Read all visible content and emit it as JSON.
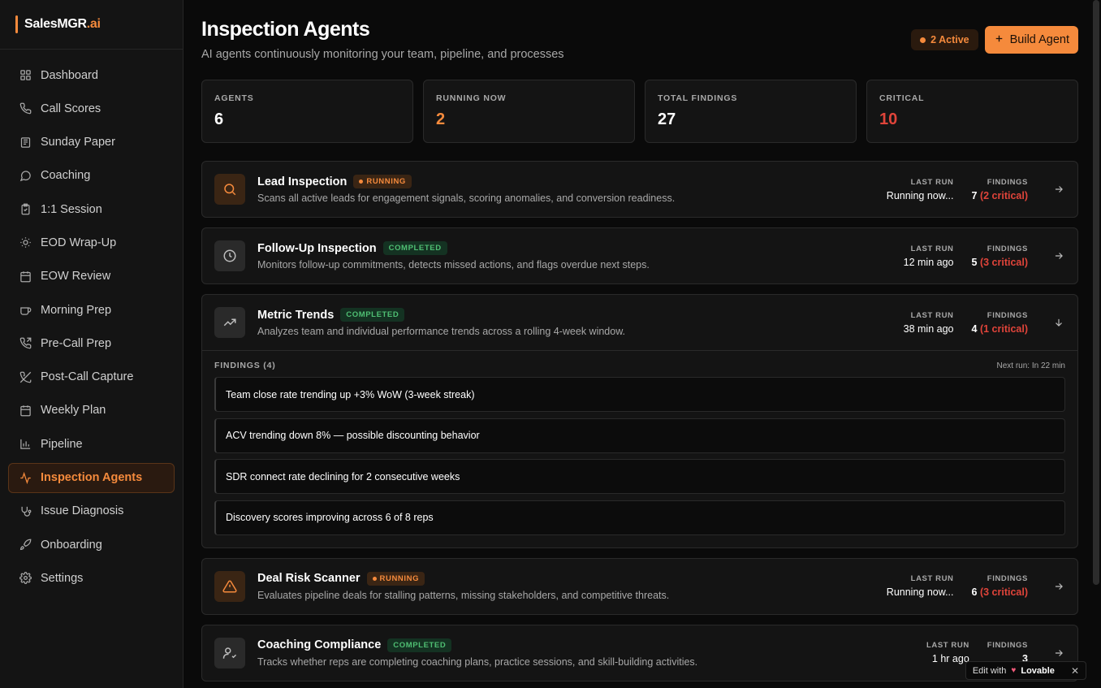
{
  "brand": {
    "name": "SalesMGR",
    "suffix": ".ai"
  },
  "sidebar": {
    "items": [
      {
        "label": "Dashboard",
        "icon": "grid-icon"
      },
      {
        "label": "Call Scores",
        "icon": "phone-icon"
      },
      {
        "label": "Sunday Paper",
        "icon": "newspaper-icon"
      },
      {
        "label": "Coaching",
        "icon": "message-circle-icon"
      },
      {
        "label": "1:1 Session",
        "icon": "clipboard-icon"
      },
      {
        "label": "EOD Wrap-Up",
        "icon": "sun-icon"
      },
      {
        "label": "EOW Review",
        "icon": "calendar-icon"
      },
      {
        "label": "Morning Prep",
        "icon": "coffee-icon"
      },
      {
        "label": "Pre-Call Prep",
        "icon": "phone-forward-icon"
      },
      {
        "label": "Post-Call Capture",
        "icon": "phone-off-icon"
      },
      {
        "label": "Weekly Plan",
        "icon": "calendar-icon"
      },
      {
        "label": "Pipeline",
        "icon": "bar-chart-icon"
      },
      {
        "label": "Inspection Agents",
        "icon": "activity-icon",
        "active": true
      },
      {
        "label": "Issue Diagnosis",
        "icon": "stethoscope-icon"
      },
      {
        "label": "Onboarding",
        "icon": "rocket-icon"
      },
      {
        "label": "Settings",
        "icon": "gear-icon"
      }
    ]
  },
  "header": {
    "title": "Inspection Agents",
    "subtitle": "AI agents continuously monitoring your team, pipeline, and processes",
    "active_count": "2 Active",
    "build_button": "Build Agent"
  },
  "stats": [
    {
      "label": "AGENTS",
      "value": "6",
      "tone": "default"
    },
    {
      "label": "RUNNING NOW",
      "value": "2",
      "tone": "orange"
    },
    {
      "label": "TOTAL FINDINGS",
      "value": "27",
      "tone": "default"
    },
    {
      "label": "CRITICAL",
      "value": "10",
      "tone": "red"
    }
  ],
  "labels": {
    "last_run": "LAST RUN",
    "findings": "FINDINGS"
  },
  "agents": [
    {
      "name": "Lead Inspection",
      "status": "RUNNING",
      "icon": "search-icon",
      "description": "Scans all active leads for engagement signals, scoring anomalies, and conversion readiness.",
      "last_run": "Running now...",
      "findings_count": "7",
      "findings_critical": "(2 critical)"
    },
    {
      "name": "Follow-Up Inspection",
      "status": "COMPLETED",
      "icon": "clock-icon",
      "description": "Monitors follow-up commitments, detects missed actions, and flags overdue next steps.",
      "last_run": "12 min ago",
      "findings_count": "5",
      "findings_critical": "(3 critical)"
    },
    {
      "name": "Metric Trends",
      "status": "COMPLETED",
      "icon": "trending-up-icon",
      "description": "Analyzes team and individual performance trends across a rolling 4-week window.",
      "last_run": "38 min ago",
      "findings_count": "4",
      "findings_critical": "(1 critical)",
      "expanded": true,
      "findings_label": "FINDINGS (4)",
      "next_run": "Next run: In 22 min",
      "findings": [
        "Team close rate trending up +3% WoW (3-week streak)",
        "ACV trending down 8% — possible discounting behavior",
        "SDR connect rate declining for 2 consecutive weeks",
        "Discovery scores improving across 6 of 8 reps"
      ]
    },
    {
      "name": "Deal Risk Scanner",
      "status": "RUNNING",
      "icon": "alert-triangle-icon",
      "description": "Evaluates pipeline deals for stalling patterns, missing stakeholders, and competitive threats.",
      "last_run": "Running now...",
      "findings_count": "6",
      "findings_critical": "(3 critical)"
    },
    {
      "name": "Coaching Compliance",
      "status": "COMPLETED",
      "icon": "user-check-icon",
      "description": "Tracks whether reps are completing coaching plans, practice sessions, and skill-building activities.",
      "last_run": "1 hr ago",
      "findings_count": "3",
      "findings_critical": ""
    }
  ],
  "lovable": {
    "prefix": "Edit with",
    "brand": "Lovable",
    "close": "✕"
  },
  "colors": {
    "accent": "#f58a3c",
    "critical": "#e0443a",
    "success": "#4fbf73"
  }
}
